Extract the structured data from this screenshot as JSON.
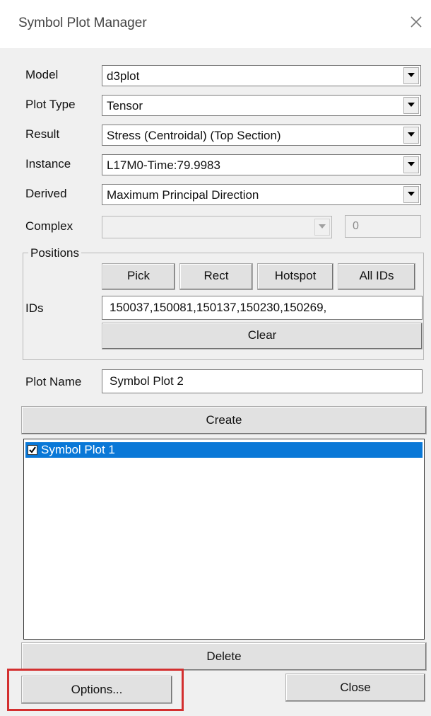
{
  "window": {
    "title": "Symbol Plot Manager",
    "close_icon": "close-icon"
  },
  "fields": {
    "model": {
      "label": "Model",
      "value": "d3plot"
    },
    "plot_type": {
      "label": "Plot Type",
      "value": "Tensor"
    },
    "result": {
      "label": "Result",
      "value": "Stress (Centroidal) (Top Section)"
    },
    "instance": {
      "label": "Instance",
      "value": "L17M0-Time:79.9983"
    },
    "derived": {
      "label": "Derived",
      "value": "Maximum Principal Direction"
    },
    "complex": {
      "label": "Complex",
      "value": "",
      "spin_value": "0"
    }
  },
  "positions": {
    "legend": "Positions",
    "pick": "Pick",
    "rect": "Rect",
    "hotspot": "Hotspot",
    "all_ids": "All IDs",
    "ids_label": "IDs",
    "ids_value": "150037,150081,150137,150230,150269,",
    "clear": "Clear"
  },
  "plot_name": {
    "label": "Plot Name",
    "value": "Symbol Plot 2"
  },
  "create_label": "Create",
  "plots_list": [
    {
      "name": "Symbol Plot 1",
      "checked": true,
      "selected": true
    }
  ],
  "delete_label": "Delete",
  "options_label": "Options...",
  "close_label": "Close",
  "colors": {
    "selection": "#0a78d7",
    "highlight": "#d32f2f",
    "panel": "#f0f0f0"
  }
}
